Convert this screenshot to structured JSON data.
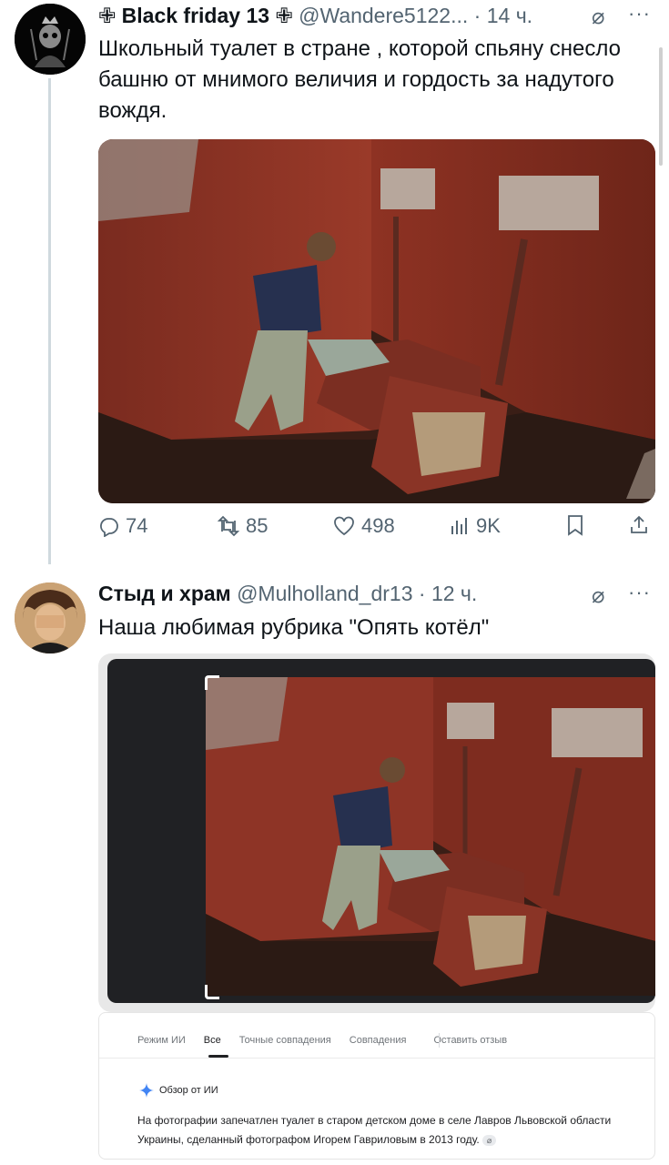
{
  "tweet1": {
    "display_name": "Black friday 13",
    "handle": "@Wandere5122...",
    "dot": "·",
    "time": "14 ч.",
    "text": "Школьный туалет в стране , которой спьяну снесло башню от мнимого величия и гордость за надутого вождя.",
    "cross_glyph": "✙",
    "more_glyph": "···",
    "grok_glyph": "⌀",
    "stats": {
      "replies": "74",
      "reposts": "85",
      "likes": "498",
      "views": "9K"
    }
  },
  "tweet2": {
    "display_name": "Стыд и храм",
    "handle": "@Mulholland_dr13",
    "dot": "·",
    "time": "12 ч.",
    "text": "Наша любимая рубрика \"Опять котёл\"",
    "more_glyph": "···",
    "grok_glyph": "⌀"
  },
  "search_panel": {
    "tabs": [
      "Режим ИИ",
      "Все",
      "Точные совпадения",
      "Совпадения",
      "Оставить отзыв"
    ],
    "active_tab": "Все",
    "ai_title": "Обзор от ИИ",
    "ai_text": "На фотографии запечатлен туалет в старом детском доме в селе Лавров Львовской области Украины, сделанный фотографом Игорем Гавриловым в 2013 году.",
    "link_glyph": "⌀"
  },
  "icons": {
    "reply": "reply-icon",
    "repost": "repost-icon",
    "like": "heart-icon",
    "views": "views-icon",
    "bookmark": "bookmark-icon",
    "share": "share-icon",
    "grok": "grok-icon",
    "more": "more-icon",
    "sparkle": "sparkle-icon"
  },
  "colors": {
    "text": "#0f1419",
    "muted": "#536471",
    "thread_line": "#cfd9de",
    "ai_accent": "#4285f4"
  }
}
